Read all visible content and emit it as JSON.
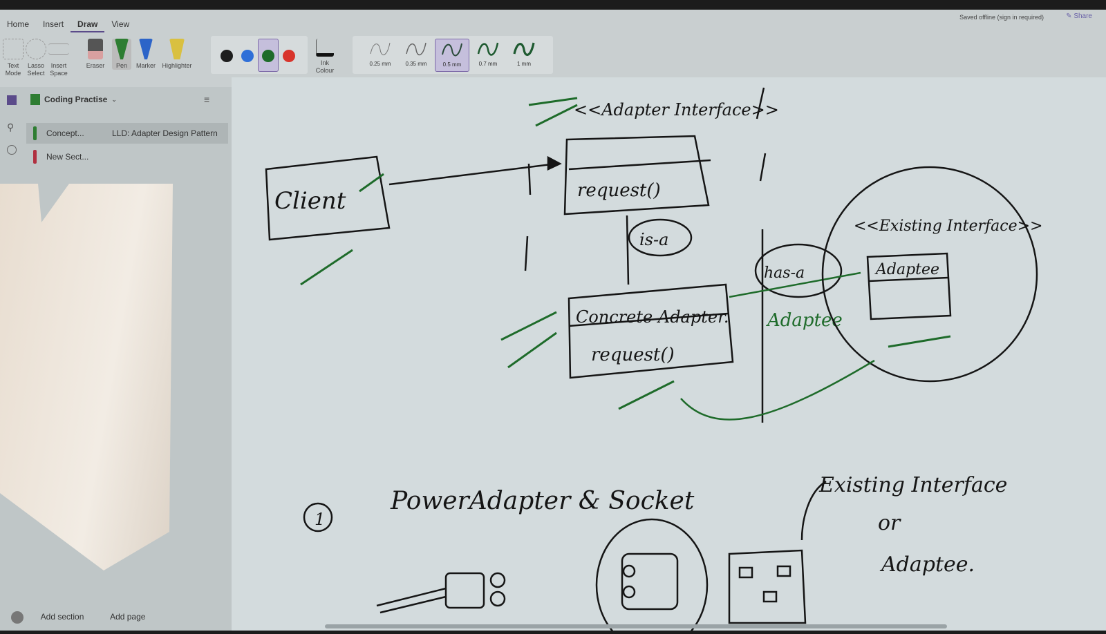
{
  "menu": {
    "tabs": [
      "Home",
      "Insert",
      "Draw",
      "View"
    ],
    "active": "Draw"
  },
  "status": "Saved offline (sign in required)",
  "share": "Share",
  "tools": {
    "text_mode": "Text Mode",
    "lasso": "Lasso Select",
    "insert_space": "Insert Space",
    "eraser": "Eraser",
    "pen": "Pen",
    "marker": "Marker",
    "highlighter": "Highlighter",
    "ink_colour": "Ink Colour"
  },
  "colors": [
    "#1e1e1e",
    "#2f6fd8",
    "#1e6b2a",
    "#d8342b"
  ],
  "selected_color": "#1e6b2a",
  "widths": [
    "0.25 mm",
    "0.35 mm",
    "0.5 mm",
    "0.7 mm",
    "1 mm"
  ],
  "selected_width": "0.5 mm",
  "sidebar": {
    "notebook": "Coding Practise",
    "sections": [
      {
        "label": "Concept...",
        "color": "#2e7d32",
        "page": "LLD: Adapter Design Pattern"
      },
      {
        "label": "New Sect...",
        "color": "#b03040"
      }
    ],
    "add_section": "Add section",
    "add_page": "Add page"
  },
  "ink": {
    "adapter_interface": "<<Adapter Interface>>",
    "client": "Client",
    "request1": "request()",
    "is_a": "is-a",
    "concrete": "Concrete Adapter.",
    "request2": "request()",
    "has_a": "has-a",
    "adaptee_green": "Adaptee",
    "existing": "<<Existing Interface>>",
    "adaptee_box": "Adaptee",
    "number": "1",
    "power": "PowerAdapter & Socket",
    "existing2": "Existing Interface",
    "or": "or",
    "adaptee2": "Adaptee."
  }
}
